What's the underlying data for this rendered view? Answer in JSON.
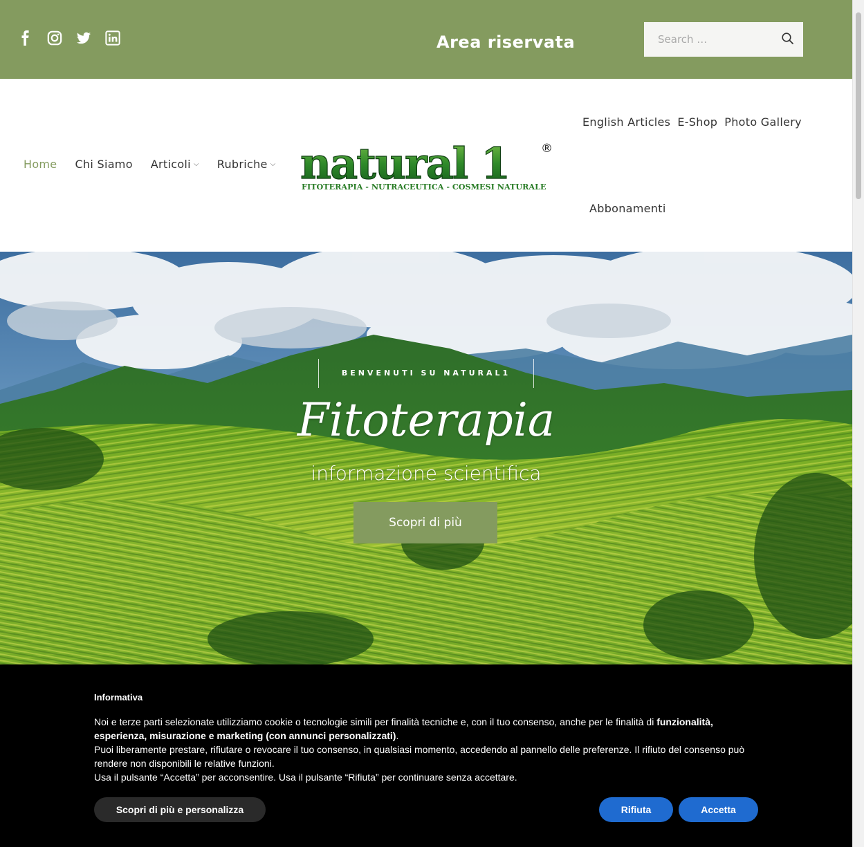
{
  "topbar": {
    "social_icons": [
      "facebook-icon",
      "instagram-icon",
      "twitter-icon",
      "linkedin-icon"
    ],
    "area_label": "Area riservata",
    "search": {
      "placeholder": "Search …",
      "icon": "search-icon"
    }
  },
  "nav": {
    "left": [
      {
        "label": "Home",
        "active": true
      },
      {
        "label": "Chi Siamo"
      },
      {
        "label": "Articoli",
        "dropdown": true
      },
      {
        "label": "Rubriche",
        "dropdown": true
      }
    ],
    "right": [
      {
        "label": "English Articles"
      },
      {
        "label": "E-Shop"
      },
      {
        "label": "Photo Gallery"
      },
      {
        "label": "Abbonamenti"
      }
    ],
    "caret_glyph": "⌵"
  },
  "logo": {
    "wordmark": "natural 1",
    "registered": "®",
    "tagline": "FITOTERAPIA - NUTRACEUTICA - COSMESI NATURALE"
  },
  "hero": {
    "kicker": "BENVENUTI SU NATURAL1",
    "title": "Fitoterapia",
    "subtitle": "informazione scientifica",
    "button": "Scopri di più"
  },
  "cookie": {
    "title": "Informativa",
    "p1_a": "Noi e terze parti selezionate utilizziamo cookie o tecnologie simili per finalità tecniche e, con il tuo consenso, anche per le finalità di ",
    "p1_b": "funzionalità, esperienza, misurazione e marketing (con annunci personalizzati)",
    "p1_c": ".",
    "p2": "Puoi liberamente prestare, rifiutare o revocare il tuo consenso, in qualsiasi momento, accedendo al pannello delle preferenze. Il rifiuto del consenso può rendere non disponibili le relative funzioni.",
    "p3": "Usa il pulsante “Accetta” per acconsentire. Usa il pulsante “Rifiuta” per continuare senza accettare.",
    "btn_more": "Scopri di più e personalizza",
    "btn_reject": "Rifiuta",
    "btn_accept": "Accetta"
  },
  "colors": {
    "brand_green": "#849b5f",
    "cookie_bg": "#000000",
    "cookie_button_blue": "#1f6bd0"
  }
}
